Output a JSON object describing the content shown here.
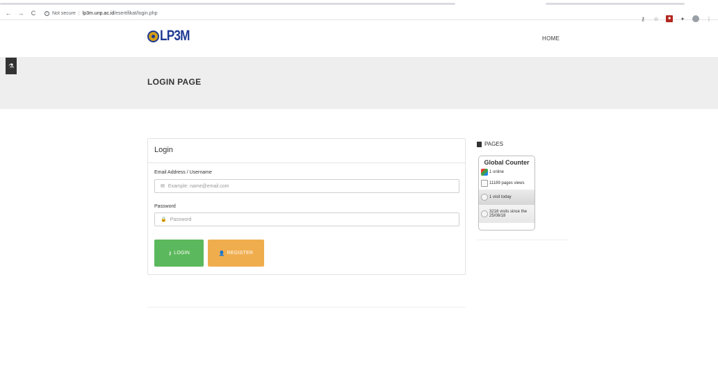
{
  "browser": {
    "back": "←",
    "forward": "→",
    "reload": "C",
    "security_label": "Not secure",
    "url_host": "lp3m.unp.ac.id",
    "url_path": "/esertifikat/login.php",
    "icons": [
      "key-icon",
      "star-icon",
      "pdf-extension-icon",
      "extensions-icon",
      "profile-avatar",
      "menu-icon"
    ]
  },
  "site": {
    "logo_text": "LP3M",
    "nav_home": "HOME",
    "banner_title": "LOGIN PAGE"
  },
  "login": {
    "heading": "Login",
    "email_label": "Email Address / Username",
    "email_placeholder": "Example: name@email.com",
    "password_label": "Password",
    "password_placeholder": "Password",
    "login_button": "LOGIN",
    "register_button": "REGISTER"
  },
  "sidebar": {
    "pages_heading": "PAGES",
    "counter": {
      "title": "Global Counter",
      "online": "1 online",
      "pages_views": "11189 pages views",
      "visit_today": "1 visit today",
      "visits_since": "3216 visits since the 25/08/18"
    }
  },
  "colors": {
    "login_button": "#5cb85c",
    "register_button": "#f0ad4e",
    "banner_bg": "#eeeeee",
    "logo": "#1f3a93"
  }
}
